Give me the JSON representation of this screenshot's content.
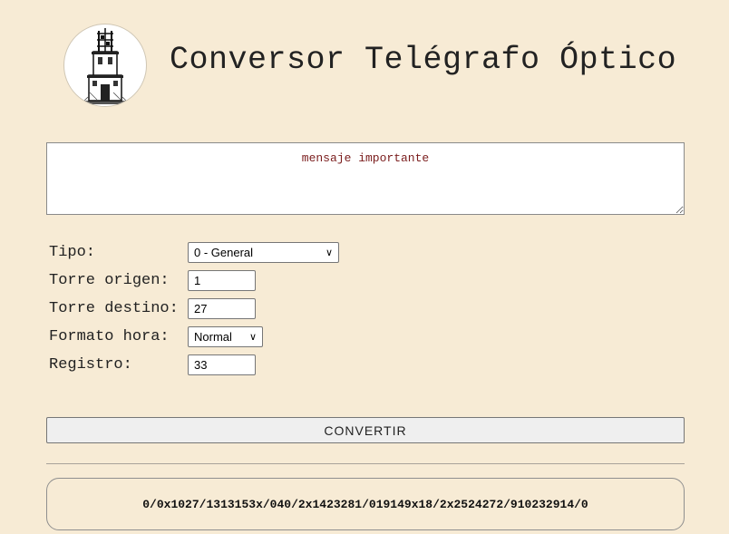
{
  "header": {
    "title": "Conversor Telégrafo Óptico",
    "logo_icon": "telegraph-tower-icon"
  },
  "message": {
    "value": "mensaje importante"
  },
  "form": {
    "tipo": {
      "label": "Tipo:",
      "value": "0 - General"
    },
    "torre_origen": {
      "label": "Torre origen:",
      "value": "1"
    },
    "torre_destino": {
      "label": "Torre destino:",
      "value": "27"
    },
    "formato_hora": {
      "label": "Formato hora:",
      "value": "Normal"
    },
    "registro": {
      "label": "Registro:",
      "value": "33"
    }
  },
  "actions": {
    "convert_label": "CONVERTIR"
  },
  "output": {
    "code": "0/0x1027/1313153x/040/2x1423281/019149x18/2x2524272/910232914/0"
  },
  "colors": {
    "background": "#f7ebd5",
    "message_text": "#7a1c1c"
  }
}
